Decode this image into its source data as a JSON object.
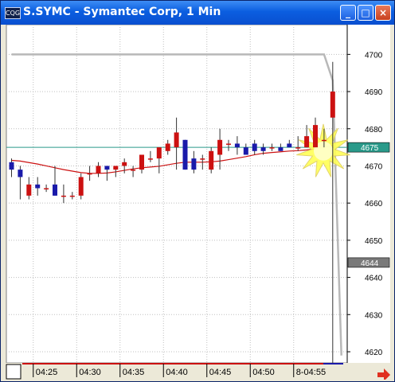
{
  "window": {
    "title": "S.SYMC - Symantec Corp, 1 Min",
    "icon": "chart-app-icon",
    "icon_text": "CQG",
    "buttons": [
      "minimize",
      "maximize",
      "close"
    ]
  },
  "colors": {
    "up_candle": "#cc1111",
    "down_candle": "#1a1aaa",
    "moving_average": "#cc1111",
    "horizontal_line": "#2a9a8a",
    "volume_line": "#b8b8b8",
    "grid": "#bfbfbf",
    "price_label_bg": "#7a7a7a",
    "scroll_arrow": "#e03020"
  },
  "chart_data": {
    "type": "candlestick",
    "title": "S.SYMC - Symantec Corp, 1 Min",
    "ylim": [
      4617,
      4708
    ],
    "y_ticks": [
      4620,
      4630,
      4640,
      4650,
      4660,
      4670,
      4680,
      4690,
      4700
    ],
    "x_ticks": [
      "04:25",
      "04:30",
      "04:35",
      "04:40",
      "04:45",
      "04:50",
      "8-04:55"
    ],
    "price_labels": [
      {
        "value": 4675,
        "text": "4675",
        "style": "highlight"
      },
      {
        "value": 4644,
        "text": "4644",
        "style": "dark"
      }
    ],
    "horizontal_line": 4675,
    "candles": [
      {
        "o": 4671,
        "h": 4672,
        "l": 4667,
        "c": 4669
      },
      {
        "o": 4669,
        "h": 4670,
        "l": 4661,
        "c": 4667
      },
      {
        "o": 4662,
        "h": 4667,
        "l": 4661,
        "c": 4665
      },
      {
        "o": 4665,
        "h": 4667,
        "l": 4662,
        "c": 4664
      },
      {
        "o": 4664,
        "h": 4665,
        "l": 4663,
        "c": 4664
      },
      {
        "o": 4665,
        "h": 4670,
        "l": 4662,
        "c": 4662
      },
      {
        "o": 4662,
        "h": 4665,
        "l": 4660,
        "c": 4662
      },
      {
        "o": 4662,
        "h": 4663,
        "l": 4661,
        "c": 4662
      },
      {
        "o": 4662,
        "h": 4668,
        "l": 4661,
        "c": 4667
      },
      {
        "o": 4668,
        "h": 4670,
        "l": 4666,
        "c": 4668
      },
      {
        "o": 4668,
        "h": 4671,
        "l": 4667,
        "c": 4670
      },
      {
        "o": 4670,
        "h": 4670,
        "l": 4666,
        "c": 4669
      },
      {
        "o": 4669,
        "h": 4670,
        "l": 4667,
        "c": 4670
      },
      {
        "o": 4670,
        "h": 4672,
        "l": 4668,
        "c": 4671
      },
      {
        "o": 4669,
        "h": 4670,
        "l": 4667,
        "c": 4669
      },
      {
        "o": 4669,
        "h": 4673,
        "l": 4668,
        "c": 4673
      },
      {
        "o": 4672,
        "h": 4674,
        "l": 4671,
        "c": 4672
      },
      {
        "o": 4672,
        "h": 4674,
        "l": 4668,
        "c": 4675
      },
      {
        "o": 4674,
        "h": 4677,
        "l": 4673,
        "c": 4676
      },
      {
        "o": 4675,
        "h": 4683,
        "l": 4669,
        "c": 4679
      },
      {
        "o": 4677,
        "h": 4677,
        "l": 4669,
        "c": 4669
      },
      {
        "o": 4672,
        "h": 4674,
        "l": 4668,
        "c": 4669
      },
      {
        "o": 4672,
        "h": 4673,
        "l": 4669,
        "c": 4672
      },
      {
        "o": 4669,
        "h": 4675,
        "l": 4668,
        "c": 4674
      },
      {
        "o": 4673,
        "h": 4680,
        "l": 4669,
        "c": 4677
      },
      {
        "o": 4676,
        "h": 4677,
        "l": 4674,
        "c": 4676
      },
      {
        "o": 4676,
        "h": 4678,
        "l": 4673,
        "c": 4675
      },
      {
        "o": 4675,
        "h": 4676,
        "l": 4673,
        "c": 4673
      },
      {
        "o": 4676,
        "h": 4677,
        "l": 4673,
        "c": 4674
      },
      {
        "o": 4675,
        "h": 4676,
        "l": 4673,
        "c": 4674
      },
      {
        "o": 4675,
        "h": 4676,
        "l": 4674,
        "c": 4675
      },
      {
        "o": 4675,
        "h": 4676,
        "l": 4674,
        "c": 4674
      },
      {
        "o": 4676,
        "h": 4677,
        "l": 4675,
        "c": 4675
      },
      {
        "o": 4675,
        "h": 4678,
        "l": 4674,
        "c": 4675
      },
      {
        "o": 4675,
        "h": 4681,
        "l": 4675,
        "c": 4678
      },
      {
        "o": 4675,
        "h": 4683,
        "l": 4675,
        "c": 4681
      },
      {
        "o": 4677,
        "h": 4680,
        "l": 4675,
        "c": 4677
      },
      {
        "o": 4683,
        "h": 4698,
        "l": 4617,
        "c": 4690
      }
    ],
    "moving_average": [
      4671.5,
      4671.3,
      4670.9,
      4670.5,
      4670.0,
      4669.5,
      4669.0,
      4668.6,
      4668.2,
      4668.0,
      4668.0,
      4668.1,
      4668.4,
      4668.8,
      4669.2,
      4669.5,
      4669.7,
      4669.9,
      4670.3,
      4670.7,
      4671.0,
      4671.0,
      4671.0,
      4671.1,
      4671.3,
      4671.7,
      4672.1,
      4672.5,
      4673.0,
      4673.4,
      4673.6,
      4673.8,
      4674.0,
      4674.1,
      4674.3,
      4674.6,
      4675.0,
      4675.5
    ],
    "volume_line": [
      4700,
      4700,
      4700,
      4700,
      4700,
      4700,
      4700,
      4700,
      4700,
      4700,
      4700,
      4700,
      4700,
      4700,
      4700,
      4700,
      4700,
      4700,
      4700,
      4700,
      4700,
      4700,
      4700,
      4700,
      4700,
      4700,
      4700,
      4700,
      4700,
      4700,
      4700,
      4700,
      4700,
      4700,
      4700,
      4700,
      4700,
      4693,
      4619
    ]
  }
}
